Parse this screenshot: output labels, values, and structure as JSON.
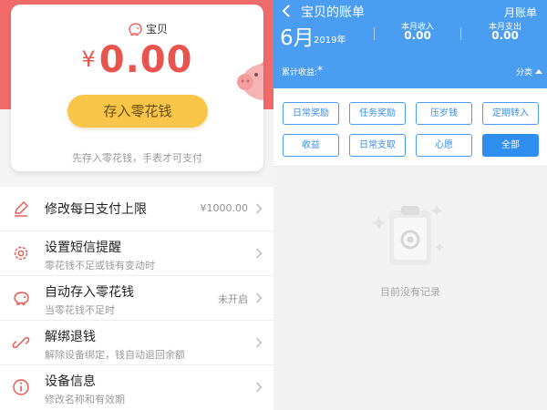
{
  "wallet": {
    "label": "宝贝",
    "currency": "¥",
    "balance": "0.00",
    "deposit_button": "存入零花钱",
    "hint": "先存入零花钱，手表才可支付"
  },
  "menu": [
    {
      "icon": "pencil-icon",
      "title": "修改每日支付上限",
      "subtitle": "",
      "value": "¥1000.00"
    },
    {
      "icon": "gear-icon",
      "title": "设置短信提醒",
      "subtitle": "零花钱不足或钱有变动时",
      "value": ""
    },
    {
      "icon": "piggy-bank-icon",
      "title": "自动存入零花钱",
      "subtitle": "当零花钱不足时",
      "value": "未开启"
    },
    {
      "icon": "unlink-icon",
      "title": "解绑退钱",
      "subtitle": "解除设备绑定，钱自动退回余额",
      "value": ""
    },
    {
      "icon": "info-icon",
      "title": "设备信息",
      "subtitle": "修改名称和有效期",
      "value": ""
    }
  ],
  "ledger": {
    "title": "宝贝的账单",
    "monthly_link": "月账单",
    "month": "6月",
    "year": "2019年",
    "income_label": "本月收入",
    "income_value": "0.00",
    "expense_label": "本月支出",
    "expense_value": "0.00",
    "cumulative_label": "累计收益:",
    "cumulative_value": "*",
    "category_label": "分类",
    "filters": [
      "日常奖励",
      "任务奖励",
      "压岁钱",
      "定期转入",
      "收益",
      "日常支取",
      "心愿",
      "全部"
    ],
    "active_filter": "全部",
    "empty_text": "目前没有记录"
  },
  "colors": {
    "accent_red": "#f26b6b",
    "balance_red": "#e9544f",
    "deposit_yellow": "#f7c548",
    "header_blue": "#4a9df0",
    "active_blue": "#2f8ff0"
  }
}
